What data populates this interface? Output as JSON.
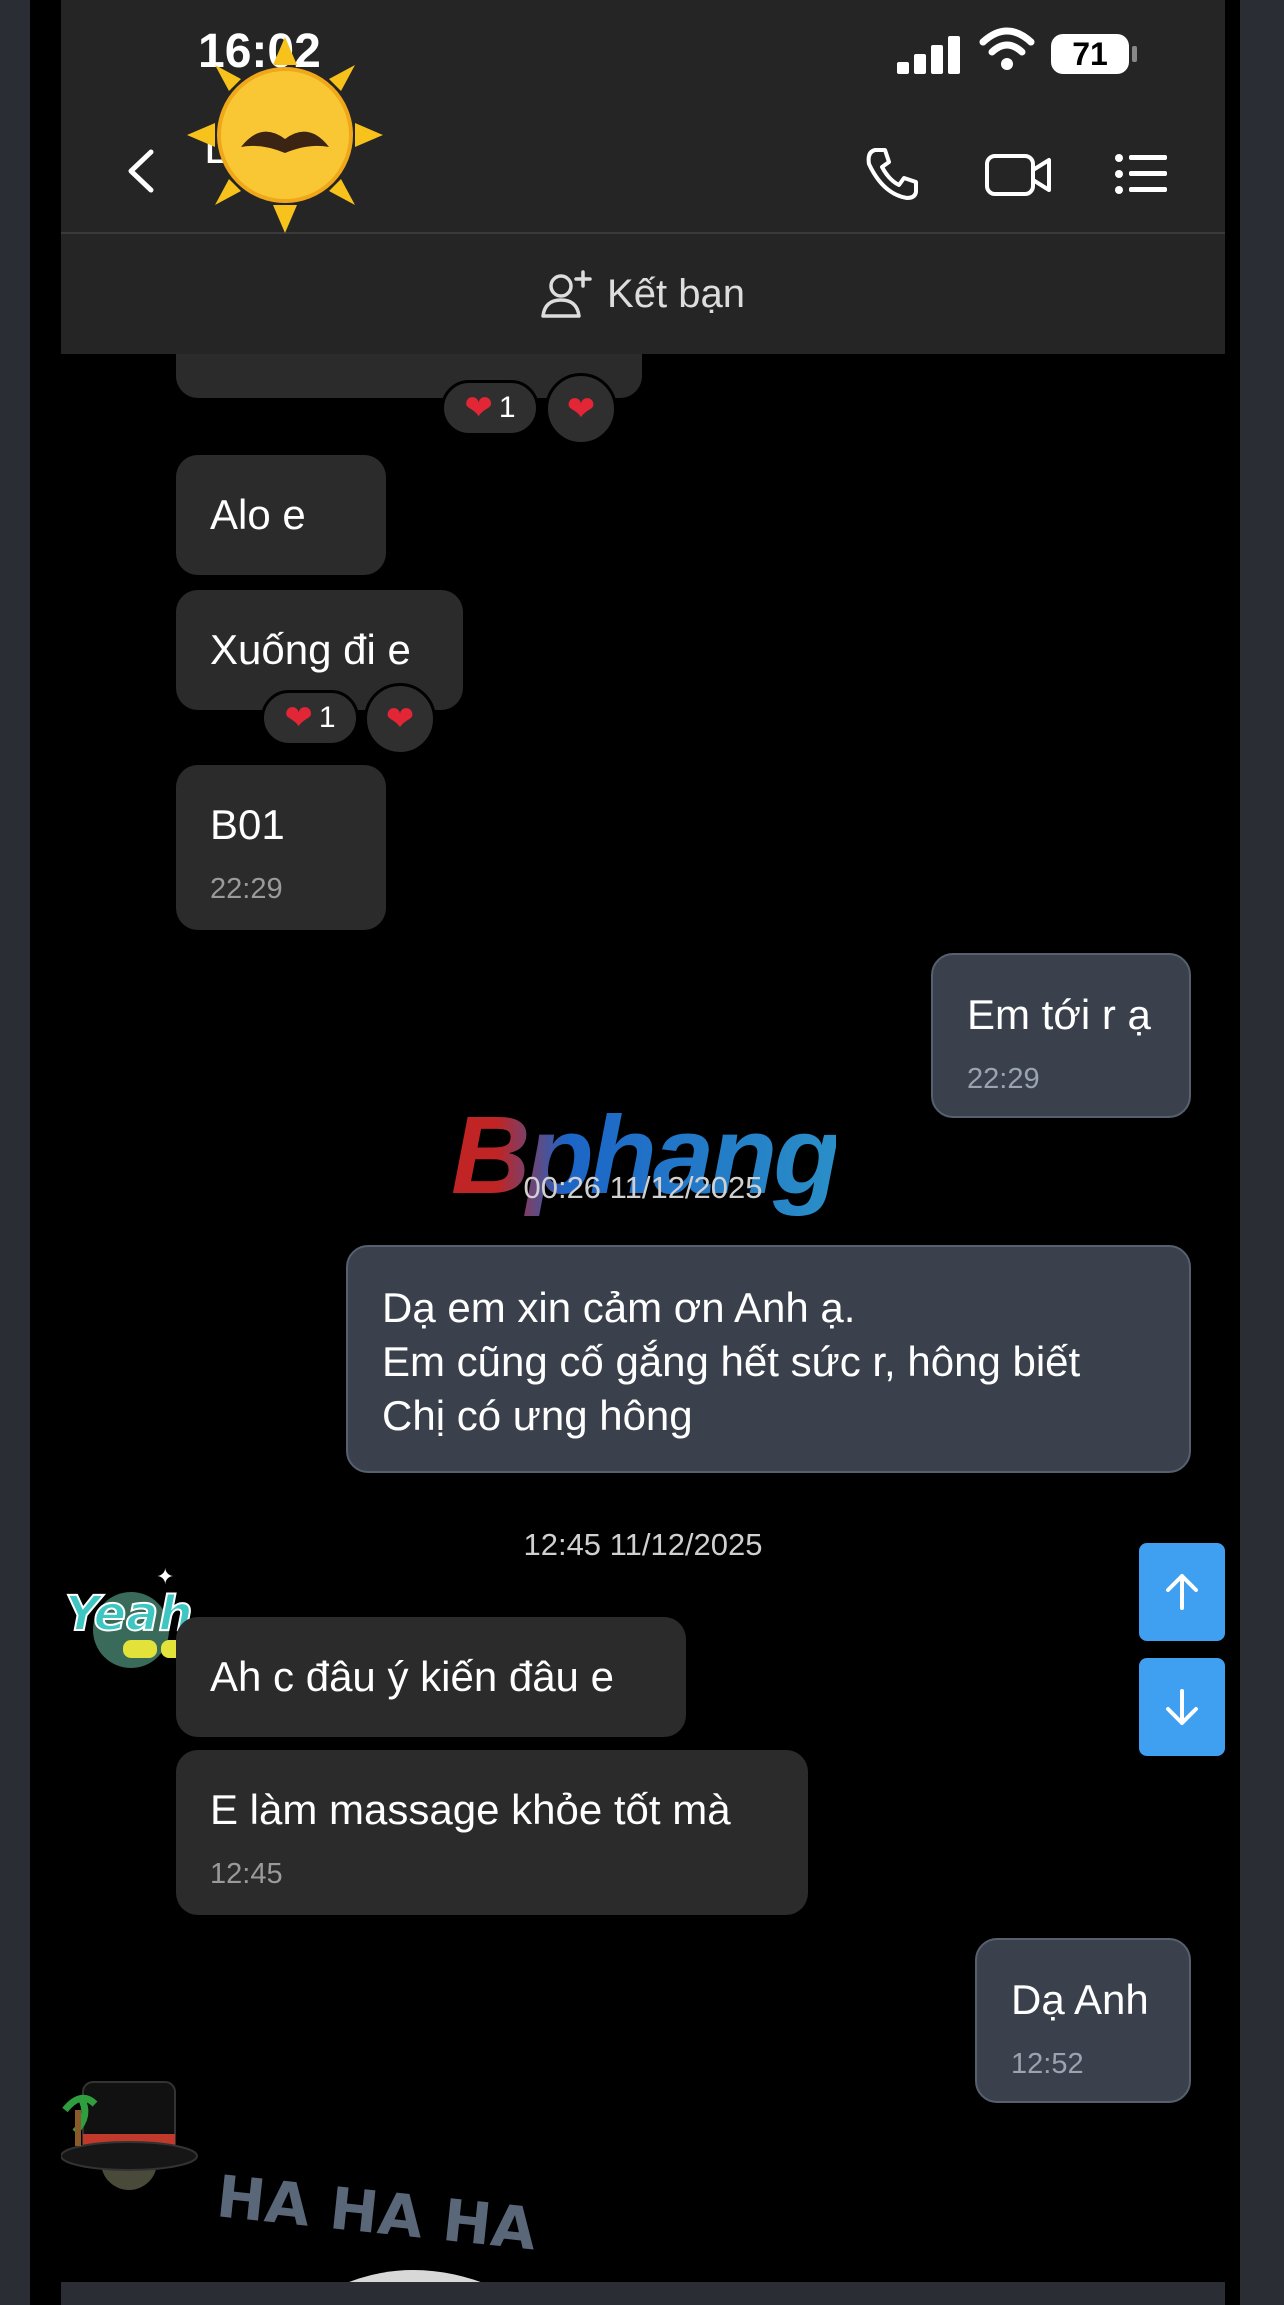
{
  "status_bar": {
    "time": "16:02",
    "battery": "71"
  },
  "header": {
    "contact_name": "L             n",
    "add_friend_label": "Kết bạn"
  },
  "watermark": "Bphang",
  "messages": [
    {
      "text": "Alo e"
    },
    {
      "text": "Xuống đi e",
      "reaction_count": "1"
    },
    {
      "text": "B01",
      "time": "22:29"
    },
    {
      "text": "Em tới r ạ",
      "time": "22:29"
    },
    {
      "text_lines": [
        "Dạ em xin cảm ơn Anh ạ.",
        "Em cũng cố gắng hết sức r, hông biết",
        "Chị có ưng hông"
      ]
    },
    {
      "text": "Ah c đâu ý kiến đâu e"
    },
    {
      "text": "E làm massage khỏe tốt mà",
      "time": "12:45"
    },
    {
      "text": "Dạ Anh",
      "time": "12:52"
    }
  ],
  "top_reaction_count": "1",
  "date_separators": [
    "00:26 11/12/2025",
    "12:45 11/12/2025"
  ],
  "stickers": {
    "yeah_text": "Yeah",
    "haha_text": "HA HA HA"
  },
  "colors": {
    "incoming_bubble": "#2b2b2b",
    "outgoing_bubble": "#3a414d",
    "accent": "#3f9ff0",
    "heart": "#e32636"
  }
}
